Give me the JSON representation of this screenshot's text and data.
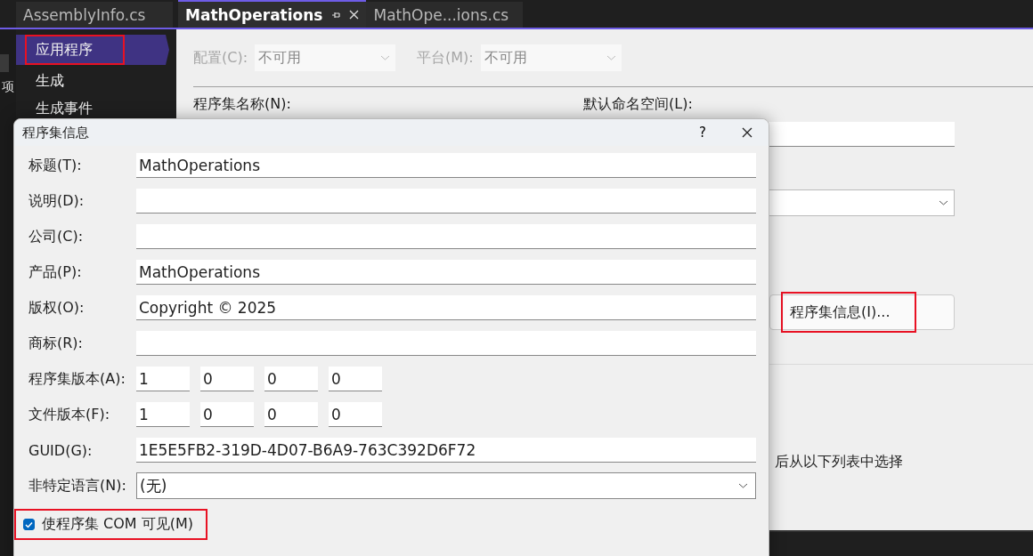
{
  "tabs": [
    {
      "label": "AssemblyInfo.cs",
      "selected": false
    },
    {
      "label": "MathOperations",
      "selected": true
    },
    {
      "label": "MathOpe...ions.cs",
      "selected": false
    }
  ],
  "left_strip": {
    "text": "项"
  },
  "sidebar": {
    "items": [
      {
        "label": "应用程序",
        "selected": true,
        "highlighted": true
      },
      {
        "label": "生成",
        "selected": false,
        "highlighted": false
      },
      {
        "label": "生成事件",
        "selected": false,
        "highlighted": false
      }
    ]
  },
  "selectors": [
    {
      "label": "配置(C):",
      "value": "不可用",
      "disabled": true
    },
    {
      "label": "平台(M):",
      "value": "不可用",
      "disabled": true
    }
  ],
  "assembly_name_label": "程序集名称(N):",
  "default_namespace_label": "默认命名空间(L):",
  "assembly_info_button": {
    "label": "程序集信息(I)...",
    "highlighted": true
  },
  "background_text": "后从以下列表中选择",
  "dialog": {
    "title": "程序集信息",
    "help": "?",
    "fields": [
      {
        "kind": "text",
        "label": "标题(T):",
        "value": "MathOperations"
      },
      {
        "kind": "text",
        "label": "说明(D):"
      },
      {
        "kind": "text",
        "label": "公司(C):"
      },
      {
        "kind": "text",
        "label": "产品(P):",
        "value": "MathOperations"
      },
      {
        "kind": "text",
        "label": "版权(O):",
        "value": "Copyright ©  2025"
      },
      {
        "kind": "text",
        "label": "商标(R):"
      },
      {
        "kind": "version",
        "label": "程序集版本(A):",
        "values": [
          "1",
          "0",
          "0",
          "0"
        ]
      },
      {
        "kind": "version",
        "label": "文件版本(F):",
        "values": [
          "1",
          "0",
          "0",
          "0"
        ]
      },
      {
        "kind": "text",
        "label": "GUID(G):",
        "value": "1E5E5FB2-319D-4D07-B6A9-763C392D6F72"
      },
      {
        "kind": "dropdown",
        "label": "非特定语言(N):",
        "value": "(无)"
      }
    ],
    "checkbox": {
      "label": "使程序集 COM 可见(M)",
      "checked": true,
      "highlighted": true
    }
  }
}
